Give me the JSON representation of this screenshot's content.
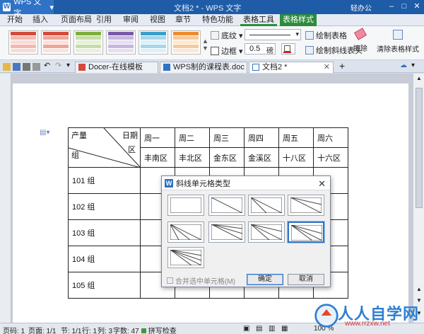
{
  "titlebar": {
    "app_name": "WPS 文字",
    "title": "文档2 * - WPS 文字",
    "user": "轻办公"
  },
  "menu": [
    "开始",
    "插入",
    "页面布局",
    "引用",
    "审阅",
    "视图",
    "章节",
    "特色功能",
    "表格工具",
    "表格样式"
  ],
  "ribbon": {
    "shading": "底纹",
    "border": "边框",
    "line_width": "0.5",
    "line_width_unit": "磅",
    "draw_table": "绘制表格",
    "draw_diag": "绘制斜线表头",
    "erase": "擦除",
    "clear_style": "清除表格样式"
  },
  "doc_tabs": [
    "Docer-在线模板",
    "WPS制的课程表.doc",
    "文档2 *"
  ],
  "table": {
    "header_label_top": "产量",
    "header_label_mid": "日期",
    "header_label_right": "区",
    "header_label_bottom": "组",
    "days": [
      "周一",
      "周二",
      "周三",
      "周四",
      "周五",
      "周六"
    ],
    "districts": [
      "丰南区",
      "丰北区",
      "金东区",
      "金溪区",
      "十八区",
      "十六区"
    ],
    "groups": [
      "101 组",
      "102 组",
      "103 组",
      "104 组",
      "105 组"
    ]
  },
  "dialog": {
    "title": "斜线单元格类型",
    "merge_label": "合并选中单元格(M)",
    "ok": "确定",
    "cancel": "取消"
  },
  "status": {
    "page": "页码: 1",
    "pages": "页面: 1/1",
    "section": "节: 1/1",
    "row": "行: 1",
    "col": "列: 3",
    "words": "字数: 47",
    "spell": "拼写检查",
    "zoom": "100 %"
  },
  "watermark": {
    "text": "人人自学网",
    "url": "www.rrzxw.net"
  }
}
